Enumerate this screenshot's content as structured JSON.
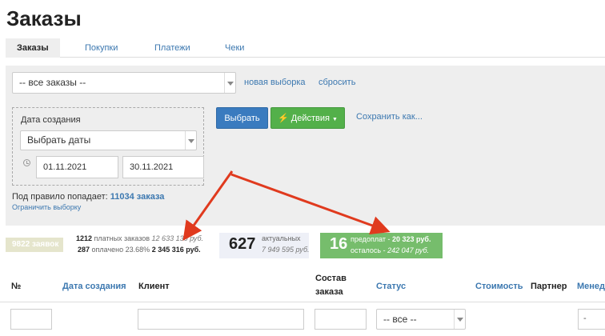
{
  "page": {
    "title": "Заказы"
  },
  "tabs": [
    {
      "label": "Заказы"
    },
    {
      "label": "Покупки"
    },
    {
      "label": "Платежи"
    },
    {
      "label": "Чеки"
    }
  ],
  "filter": {
    "selection_value": "-- все заказы --",
    "new_selection": "новая выборка",
    "reset": "сбросить",
    "date_label": "Дата создания",
    "date_select_value": "Выбрать даты",
    "date_from": "01.11.2021",
    "date_to": "30.11.2021",
    "select_button": "Выбрать",
    "actions_button": "Действия",
    "save_as": "Сохранить как...",
    "rule_prefix": "Под правило попадает:",
    "rule_count": "11034 заказа",
    "limit_link": "Ограничить выборку"
  },
  "stats": {
    "requests": "9822 заявок",
    "paid_orders_count": "1212",
    "paid_orders_label": "платных заказов",
    "paid_orders_sum": "12 633 130 руб.",
    "paid_count": "287",
    "paid_label": "оплачено 23.68%",
    "paid_sum": "2 345 316 руб.",
    "actual_count": "627",
    "actual_label": "актуальных",
    "actual_sum": "7 949 595 руб.",
    "prepay_count": "16",
    "prepay_label": "предоплат -",
    "prepay_sum": "20 323 руб.",
    "remaining_label": "осталось -",
    "remaining_sum": "242 047 руб."
  },
  "table": {
    "columns": {
      "num": "№",
      "created": "Дата создания",
      "client": "Клиент",
      "composition_1": "Состав",
      "composition_2": "заказа",
      "status": "Статус",
      "cost": "Стоимость",
      "partner": "Партнер",
      "manager": "Менед"
    },
    "status_filter_value": "-- все --"
  },
  "colors": {
    "link": "#3c78b0",
    "primary_button": "#3a7bbf",
    "success_button": "#53b04a",
    "prepay_box": "#76bd6c",
    "annotation_arrow": "#e03a1e"
  }
}
